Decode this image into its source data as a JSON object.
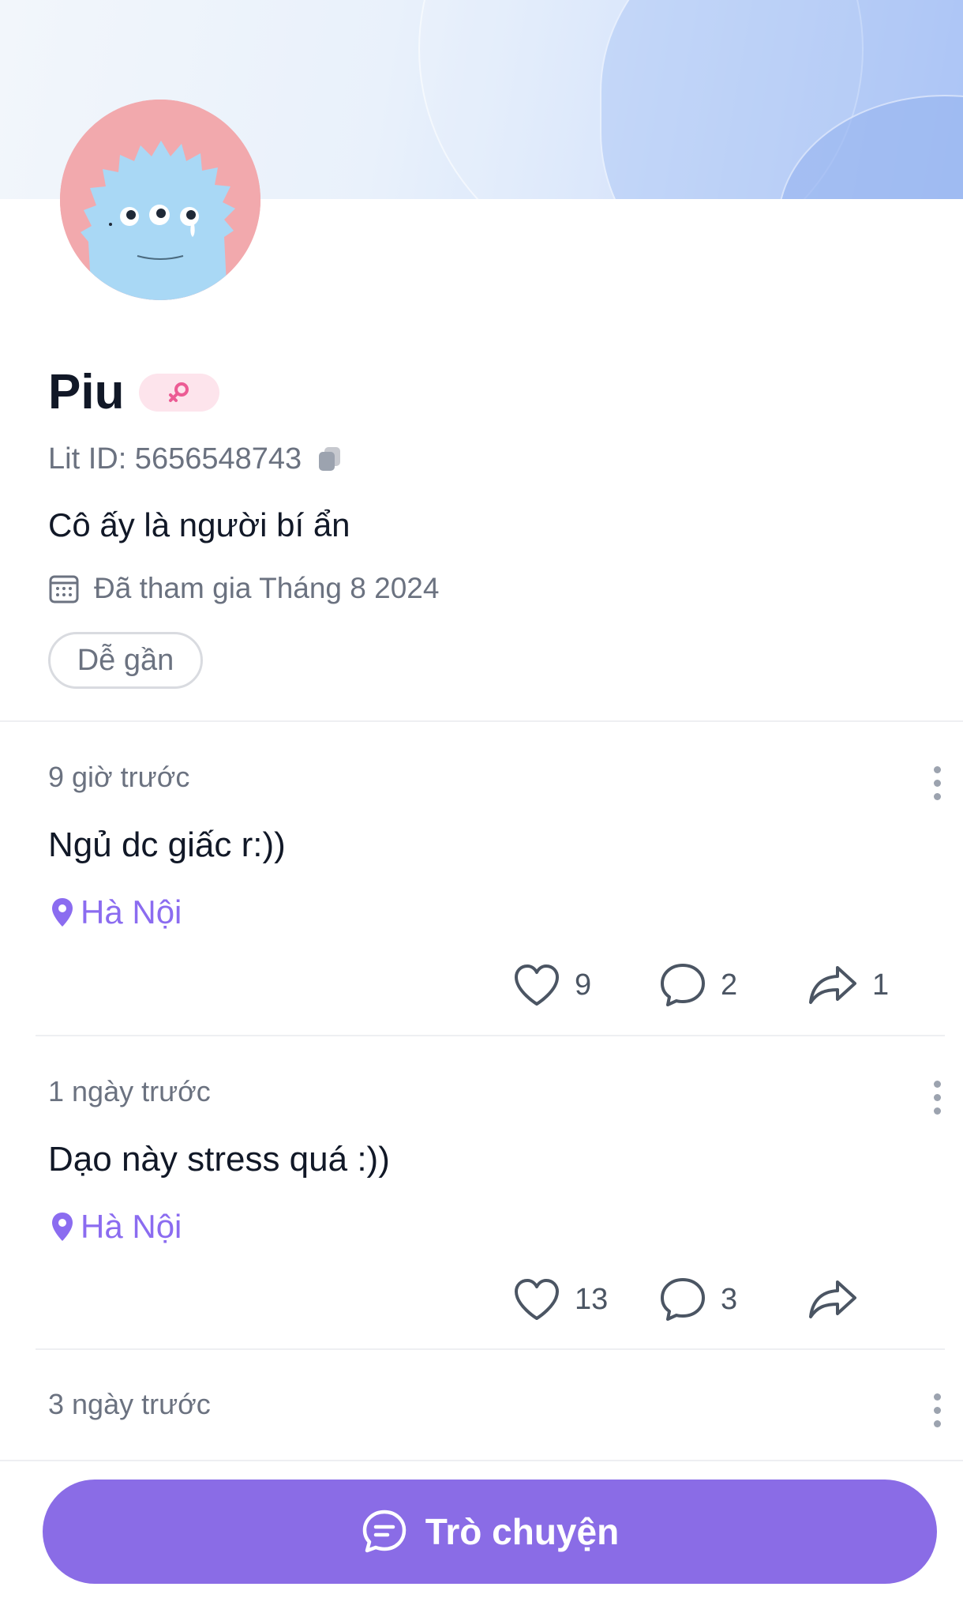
{
  "profile": {
    "name": "Piu",
    "lit_id": "Lit ID: 5656548743",
    "bio": "Cô ấy là người bí ẩn",
    "joined": "Đã tham gia Tháng 8 2024",
    "tag": "Dễ gần",
    "gender_badge_color": "#fde4ec"
  },
  "posts": [
    {
      "time": "9 giờ trước",
      "text": "Ngủ dc giấc r:))",
      "location": "Hà Nội",
      "likes": "9",
      "comments": "2",
      "shares": "1"
    },
    {
      "time": "1 ngày trước",
      "text": "Dạo này stress quá :))",
      "location": "Hà Nội",
      "likes": "13",
      "comments": "3",
      "shares": ""
    },
    {
      "time": "3 ngày trước"
    }
  ],
  "chat_button": {
    "label": "Trò chuyện"
  },
  "colors": {
    "accent": "#8a6ce6",
    "location": "#8b6cf0",
    "avatar_bg": "#f2a9ad",
    "monster": "#a9d8f5"
  }
}
